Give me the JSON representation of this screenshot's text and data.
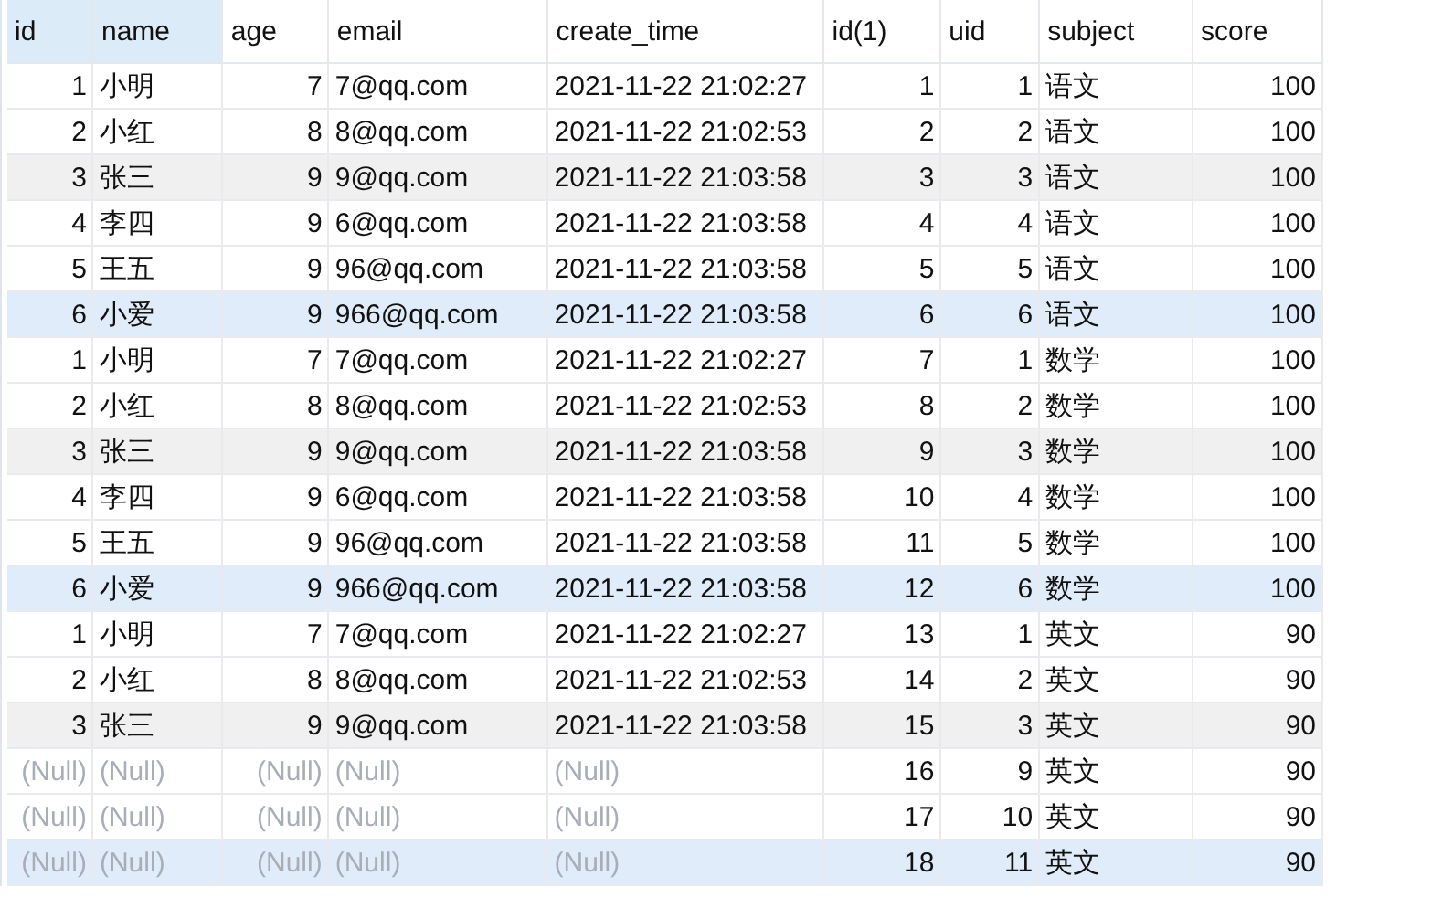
{
  "table": {
    "columns": [
      {
        "label": "id",
        "right_aligned": true,
        "selected": true
      },
      {
        "label": "name",
        "right_aligned": false,
        "selected": true
      },
      {
        "label": "age",
        "right_aligned": true,
        "selected": false
      },
      {
        "label": "email",
        "right_aligned": false,
        "selected": false
      },
      {
        "label": "create_time",
        "right_aligned": false,
        "selected": false
      },
      {
        "label": "id(1)",
        "right_aligned": true,
        "selected": false
      },
      {
        "label": "uid",
        "right_aligned": true,
        "selected": false
      },
      {
        "label": "subject",
        "right_aligned": false,
        "selected": false
      },
      {
        "label": "score",
        "right_aligned": true,
        "selected": false
      }
    ],
    "rows": [
      {
        "shaded": false,
        "selected": false,
        "cells": [
          {
            "text": "1",
            "null": false
          },
          {
            "text": "小明",
            "null": false
          },
          {
            "text": "7",
            "null": false
          },
          {
            "text": "7@qq.com",
            "null": false
          },
          {
            "text": "2021-11-22 21:02:27",
            "null": false
          },
          {
            "text": "1",
            "null": false
          },
          {
            "text": "1",
            "null": false
          },
          {
            "text": "语文",
            "null": false
          },
          {
            "text": "100",
            "null": false
          }
        ]
      },
      {
        "shaded": false,
        "selected": false,
        "cells": [
          {
            "text": "2",
            "null": false
          },
          {
            "text": "小红",
            "null": false
          },
          {
            "text": "8",
            "null": false
          },
          {
            "text": "8@qq.com",
            "null": false
          },
          {
            "text": "2021-11-22 21:02:53",
            "null": false
          },
          {
            "text": "2",
            "null": false
          },
          {
            "text": "2",
            "null": false
          },
          {
            "text": "语文",
            "null": false
          },
          {
            "text": "100",
            "null": false
          }
        ]
      },
      {
        "shaded": true,
        "selected": false,
        "cells": [
          {
            "text": "3",
            "null": false
          },
          {
            "text": "张三",
            "null": false
          },
          {
            "text": "9",
            "null": false
          },
          {
            "text": "9@qq.com",
            "null": false
          },
          {
            "text": "2021-11-22 21:03:58",
            "null": false
          },
          {
            "text": "3",
            "null": false
          },
          {
            "text": "3",
            "null": false
          },
          {
            "text": "语文",
            "null": false
          },
          {
            "text": "100",
            "null": false
          }
        ]
      },
      {
        "shaded": false,
        "selected": false,
        "cells": [
          {
            "text": "4",
            "null": false
          },
          {
            "text": "李四",
            "null": false
          },
          {
            "text": "9",
            "null": false
          },
          {
            "text": "6@qq.com",
            "null": false
          },
          {
            "text": "2021-11-22 21:03:58",
            "null": false
          },
          {
            "text": "4",
            "null": false
          },
          {
            "text": "4",
            "null": false
          },
          {
            "text": "语文",
            "null": false
          },
          {
            "text": "100",
            "null": false
          }
        ]
      },
      {
        "shaded": false,
        "selected": false,
        "cells": [
          {
            "text": "5",
            "null": false
          },
          {
            "text": "王五",
            "null": false
          },
          {
            "text": "9",
            "null": false
          },
          {
            "text": "96@qq.com",
            "null": false
          },
          {
            "text": "2021-11-22 21:03:58",
            "null": false
          },
          {
            "text": "5",
            "null": false
          },
          {
            "text": "5",
            "null": false
          },
          {
            "text": "语文",
            "null": false
          },
          {
            "text": "100",
            "null": false
          }
        ]
      },
      {
        "shaded": false,
        "selected": true,
        "cells": [
          {
            "text": "6",
            "null": false
          },
          {
            "text": "小爱",
            "null": false
          },
          {
            "text": "9",
            "null": false
          },
          {
            "text": "966@qq.com",
            "null": false
          },
          {
            "text": "2021-11-22 21:03:58",
            "null": false
          },
          {
            "text": "6",
            "null": false
          },
          {
            "text": "6",
            "null": false
          },
          {
            "text": "语文",
            "null": false
          },
          {
            "text": "100",
            "null": false
          }
        ]
      },
      {
        "shaded": false,
        "selected": false,
        "cells": [
          {
            "text": "1",
            "null": false
          },
          {
            "text": "小明",
            "null": false
          },
          {
            "text": "7",
            "null": false
          },
          {
            "text": "7@qq.com",
            "null": false
          },
          {
            "text": "2021-11-22 21:02:27",
            "null": false
          },
          {
            "text": "7",
            "null": false
          },
          {
            "text": "1",
            "null": false
          },
          {
            "text": "数学",
            "null": false
          },
          {
            "text": "100",
            "null": false
          }
        ]
      },
      {
        "shaded": false,
        "selected": false,
        "cells": [
          {
            "text": "2",
            "null": false
          },
          {
            "text": "小红",
            "null": false
          },
          {
            "text": "8",
            "null": false
          },
          {
            "text": "8@qq.com",
            "null": false
          },
          {
            "text": "2021-11-22 21:02:53",
            "null": false
          },
          {
            "text": "8",
            "null": false
          },
          {
            "text": "2",
            "null": false
          },
          {
            "text": "数学",
            "null": false
          },
          {
            "text": "100",
            "null": false
          }
        ]
      },
      {
        "shaded": true,
        "selected": false,
        "cells": [
          {
            "text": "3",
            "null": false
          },
          {
            "text": "张三",
            "null": false
          },
          {
            "text": "9",
            "null": false
          },
          {
            "text": "9@qq.com",
            "null": false
          },
          {
            "text": "2021-11-22 21:03:58",
            "null": false
          },
          {
            "text": "9",
            "null": false
          },
          {
            "text": "3",
            "null": false
          },
          {
            "text": "数学",
            "null": false
          },
          {
            "text": "100",
            "null": false
          }
        ]
      },
      {
        "shaded": false,
        "selected": false,
        "cells": [
          {
            "text": "4",
            "null": false
          },
          {
            "text": "李四",
            "null": false
          },
          {
            "text": "9",
            "null": false
          },
          {
            "text": "6@qq.com",
            "null": false
          },
          {
            "text": "2021-11-22 21:03:58",
            "null": false
          },
          {
            "text": "10",
            "null": false
          },
          {
            "text": "4",
            "null": false
          },
          {
            "text": "数学",
            "null": false
          },
          {
            "text": "100",
            "null": false
          }
        ]
      },
      {
        "shaded": false,
        "selected": false,
        "cells": [
          {
            "text": "5",
            "null": false
          },
          {
            "text": "王五",
            "null": false
          },
          {
            "text": "9",
            "null": false
          },
          {
            "text": "96@qq.com",
            "null": false
          },
          {
            "text": "2021-11-22 21:03:58",
            "null": false
          },
          {
            "text": "11",
            "null": false
          },
          {
            "text": "5",
            "null": false
          },
          {
            "text": "数学",
            "null": false
          },
          {
            "text": "100",
            "null": false
          }
        ]
      },
      {
        "shaded": false,
        "selected": true,
        "cells": [
          {
            "text": "6",
            "null": false
          },
          {
            "text": "小爱",
            "null": false
          },
          {
            "text": "9",
            "null": false
          },
          {
            "text": "966@qq.com",
            "null": false
          },
          {
            "text": "2021-11-22 21:03:58",
            "null": false
          },
          {
            "text": "12",
            "null": false
          },
          {
            "text": "6",
            "null": false
          },
          {
            "text": "数学",
            "null": false
          },
          {
            "text": "100",
            "null": false
          }
        ]
      },
      {
        "shaded": false,
        "selected": false,
        "cells": [
          {
            "text": "1",
            "null": false
          },
          {
            "text": "小明",
            "null": false
          },
          {
            "text": "7",
            "null": false
          },
          {
            "text": "7@qq.com",
            "null": false
          },
          {
            "text": "2021-11-22 21:02:27",
            "null": false
          },
          {
            "text": "13",
            "null": false
          },
          {
            "text": "1",
            "null": false
          },
          {
            "text": "英文",
            "null": false
          },
          {
            "text": "90",
            "null": false
          }
        ]
      },
      {
        "shaded": false,
        "selected": false,
        "cells": [
          {
            "text": "2",
            "null": false
          },
          {
            "text": "小红",
            "null": false
          },
          {
            "text": "8",
            "null": false
          },
          {
            "text": "8@qq.com",
            "null": false
          },
          {
            "text": "2021-11-22 21:02:53",
            "null": false
          },
          {
            "text": "14",
            "null": false
          },
          {
            "text": "2",
            "null": false
          },
          {
            "text": "英文",
            "null": false
          },
          {
            "text": "90",
            "null": false
          }
        ]
      },
      {
        "shaded": true,
        "selected": false,
        "cells": [
          {
            "text": "3",
            "null": false
          },
          {
            "text": "张三",
            "null": false
          },
          {
            "text": "9",
            "null": false
          },
          {
            "text": "9@qq.com",
            "null": false
          },
          {
            "text": "2021-11-22 21:03:58",
            "null": false
          },
          {
            "text": "15",
            "null": false
          },
          {
            "text": "3",
            "null": false
          },
          {
            "text": "英文",
            "null": false
          },
          {
            "text": "90",
            "null": false
          }
        ]
      },
      {
        "shaded": false,
        "selected": false,
        "cells": [
          {
            "text": "(Null)",
            "null": true
          },
          {
            "text": "(Null)",
            "null": true
          },
          {
            "text": "(Null)",
            "null": true
          },
          {
            "text": "(Null)",
            "null": true
          },
          {
            "text": "(Null)",
            "null": true
          },
          {
            "text": "16",
            "null": false
          },
          {
            "text": "9",
            "null": false
          },
          {
            "text": "英文",
            "null": false
          },
          {
            "text": "90",
            "null": false
          }
        ]
      },
      {
        "shaded": false,
        "selected": false,
        "cells": [
          {
            "text": "(Null)",
            "null": true
          },
          {
            "text": "(Null)",
            "null": true
          },
          {
            "text": "(Null)",
            "null": true
          },
          {
            "text": "(Null)",
            "null": true
          },
          {
            "text": "(Null)",
            "null": true
          },
          {
            "text": "17",
            "null": false
          },
          {
            "text": "10",
            "null": false
          },
          {
            "text": "英文",
            "null": false
          },
          {
            "text": "90",
            "null": false
          }
        ]
      },
      {
        "shaded": false,
        "selected": true,
        "cells": [
          {
            "text": "(Null)",
            "null": true
          },
          {
            "text": "(Null)",
            "null": true
          },
          {
            "text": "(Null)",
            "null": true
          },
          {
            "text": "(Null)",
            "null": true
          },
          {
            "text": "(Null)",
            "null": true
          },
          {
            "text": "18",
            "null": false
          },
          {
            "text": "11",
            "null": false
          },
          {
            "text": "英文",
            "null": false
          },
          {
            "text": "90",
            "null": false
          }
        ]
      }
    ]
  }
}
